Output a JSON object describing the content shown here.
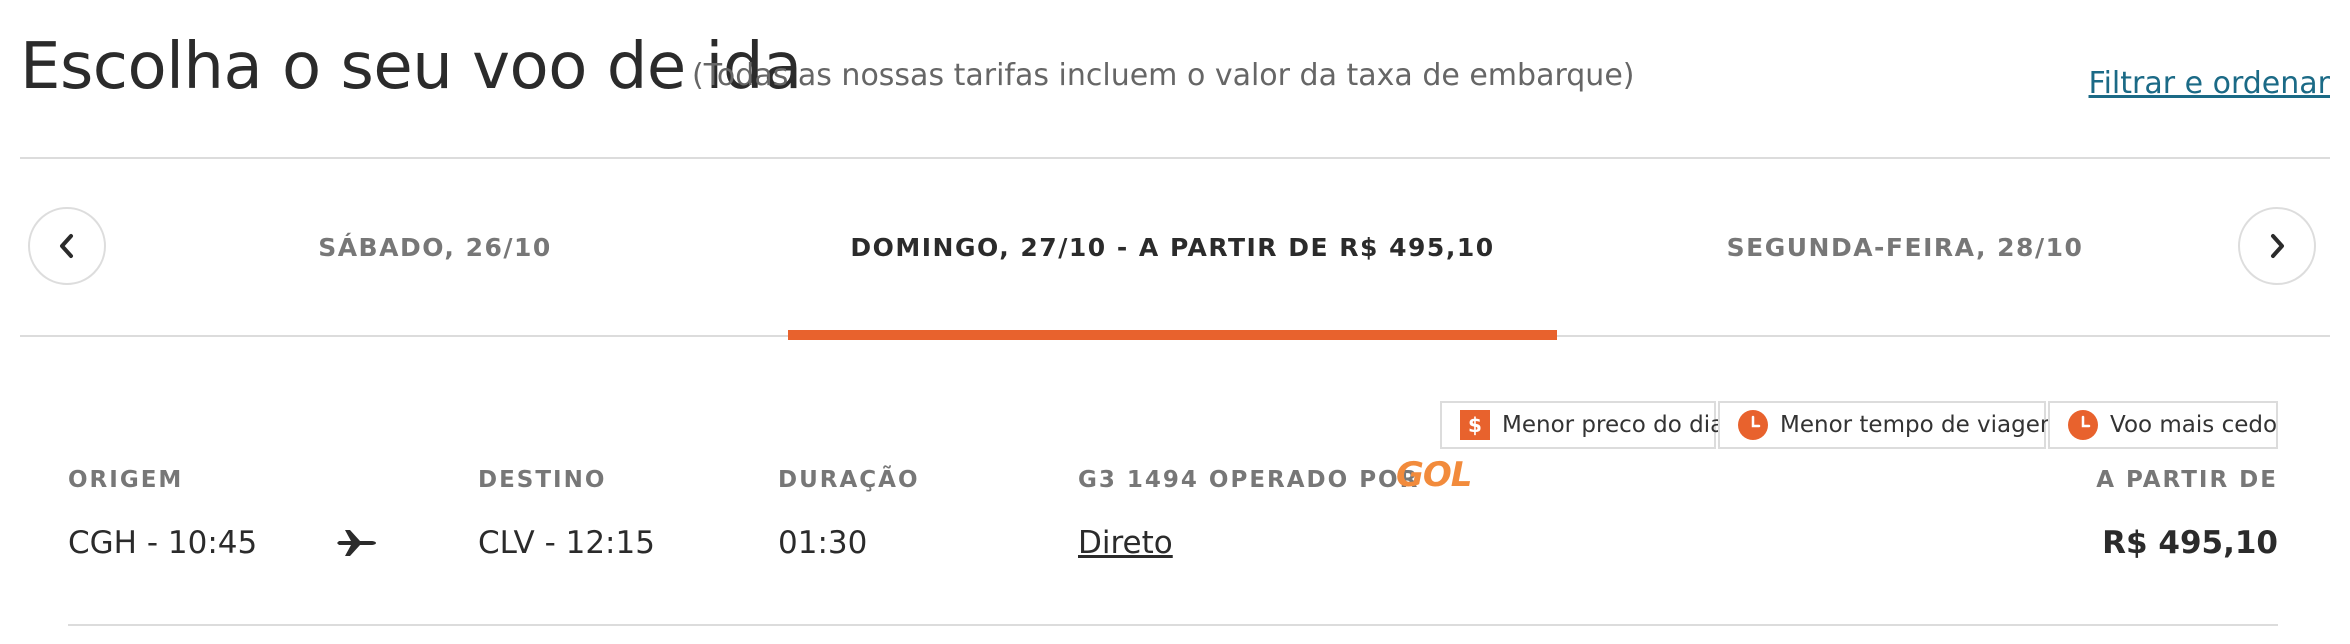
{
  "header": {
    "title": "Escolha o seu voo de ida",
    "subtitle": "(Todas as nossas tarifas incluem o valor da taxa de embarque)",
    "filter_link": "Filtrar e ordenar"
  },
  "date_tabs": [
    {
      "label": "SÁBADO, 26/10",
      "active": false
    },
    {
      "label": "DOMINGO, 27/10 - A PARTIR DE R$ 495,10",
      "active": true
    },
    {
      "label": "SEGUNDA-FEIRA, 28/10",
      "active": false
    }
  ],
  "legend": {
    "cheapest": "Menor preco do dia",
    "fastest": "Menor tempo de viagem",
    "earliest": "Voo mais cedo",
    "money_symbol": "$"
  },
  "columns": {
    "origin": "ORIGEM",
    "destination": "DESTINO",
    "duration": "DURAÇÃO",
    "flight": "G3 1494 OPERADO POR",
    "price": "A PARTIR DE"
  },
  "flight": {
    "origin": "CGH - 10:45",
    "destination": "CLV - 12:15",
    "duration": "01:30",
    "stops": "Direto",
    "price": "R$ 495,10",
    "airline_logo": "GOL"
  },
  "colors": {
    "accent": "#e8622d",
    "link": "#1b6a86"
  }
}
